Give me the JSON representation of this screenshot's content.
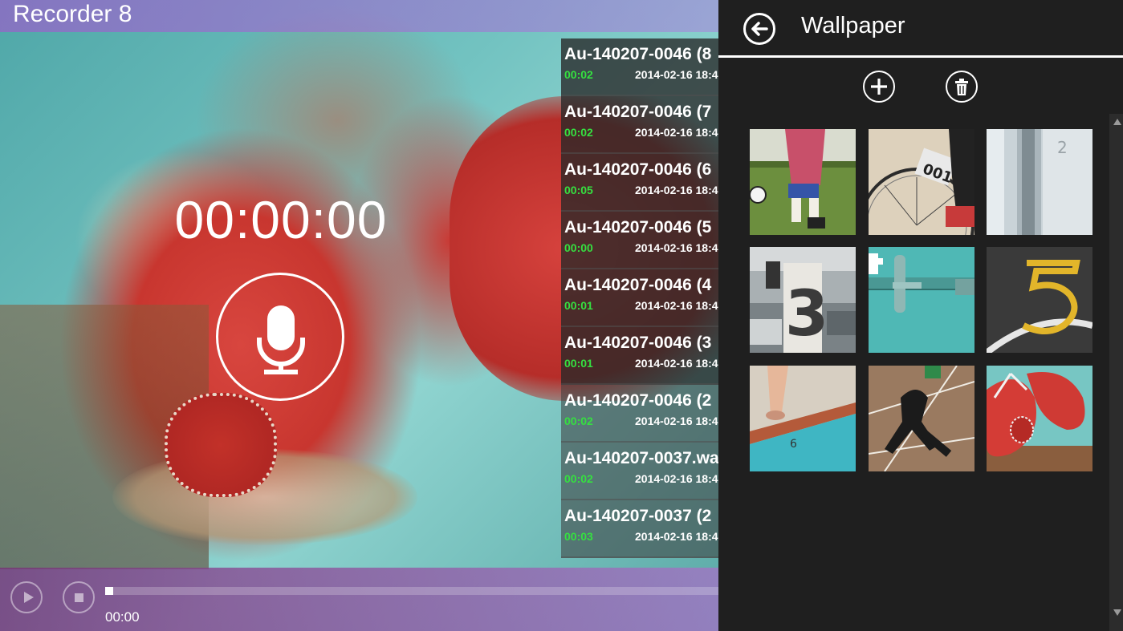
{
  "app": {
    "title": "Recorder 8",
    "timer": "00:00:00"
  },
  "recordings": [
    {
      "name": "Au-140207-0046 (8",
      "duration": "00:02",
      "date": "2014-02-16 18:4"
    },
    {
      "name": "Au-140207-0046 (7",
      "duration": "00:02",
      "date": "2014-02-16 18:4"
    },
    {
      "name": "Au-140207-0046 (6",
      "duration": "00:05",
      "date": "2014-02-16 18:4"
    },
    {
      "name": "Au-140207-0046 (5",
      "duration": "00:00",
      "date": "2014-02-16 18:4"
    },
    {
      "name": "Au-140207-0046 (4",
      "duration": "00:01",
      "date": "2014-02-16 18:4"
    },
    {
      "name": "Au-140207-0046 (3",
      "duration": "00:01",
      "date": "2014-02-16 18:4"
    },
    {
      "name": "Au-140207-0046 (2",
      "duration": "00:02",
      "date": "2014-02-16 18:4"
    },
    {
      "name": "Au-140207-0037.wa",
      "duration": "00:02",
      "date": "2014-02-16 18:4"
    },
    {
      "name": "Au-140207-0037 (2",
      "duration": "00:03",
      "date": "2014-02-16 18:4"
    }
  ],
  "player": {
    "position": "00:00",
    "progress": 0
  },
  "panel": {
    "title": "Wallpaper"
  },
  "wallpapers": [
    {
      "icon": "soccer-kid-photo"
    },
    {
      "icon": "bicycle-number-001-photo"
    },
    {
      "icon": "glass-door-number-2-photo"
    },
    {
      "icon": "parking-number-3-photo"
    },
    {
      "icon": "teal-wall-hook-photo"
    },
    {
      "icon": "asphalt-number-5-photo"
    },
    {
      "icon": "pool-edge-number-6-photo"
    },
    {
      "icon": "hopscotch-shadow-photo"
    },
    {
      "icon": "red-shoes-number-8-photo"
    }
  ],
  "colors": {
    "accent_purple": "#a06ad0",
    "duration_green": "#35e040",
    "panel_bg": "#1f1f1f"
  }
}
